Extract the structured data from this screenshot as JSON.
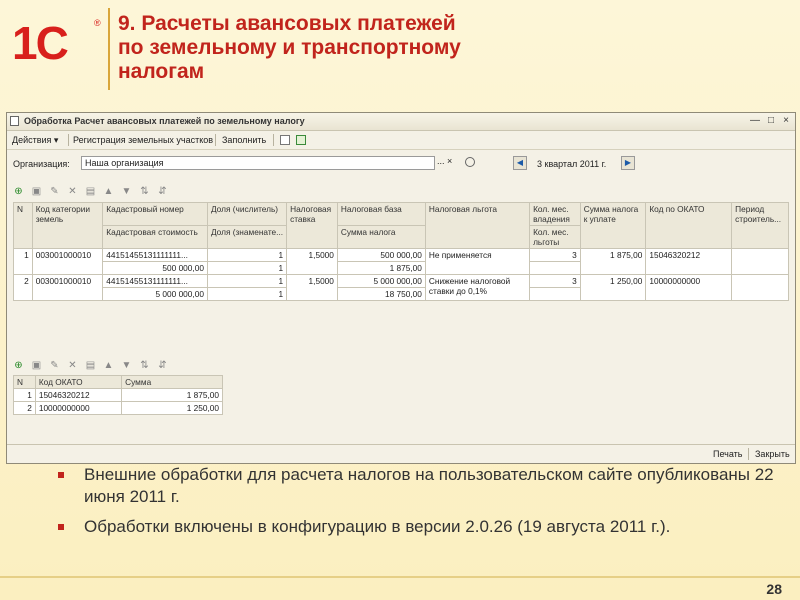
{
  "slide": {
    "title_lines": [
      "9. Расчеты авансовых платежей",
      "по земельному и транспортному",
      "налогам"
    ],
    "logo_text": "1С",
    "logo_reg": "®",
    "bullets": [
      "Внешние обработки для расчета налогов на пользовательском сайте опубликованы 22 июня 2011 г.",
      "Обработки включены в конфигурацию в версии 2.0.26 (19 августа 2011 г.)."
    ],
    "page_number": "28"
  },
  "window": {
    "title": "Обработка  Расчет авансовых платежей по земельному налогу",
    "controls": [
      "—",
      "□",
      "×"
    ],
    "commands": {
      "actions": "Действия ▾",
      "register": "Регистрация земельных участков",
      "fill": "Заполнить"
    },
    "org_label": "Организация:",
    "org_value": "Наша организация",
    "org_buttons": "...  ×",
    "period": "3 квартал 2011 г.",
    "main_table": {
      "headers_top": [
        "N",
        "Код категории земель",
        "Кадастровый номер",
        "Доля (числитель)",
        "Налоговая ставка",
        "Налоговая база",
        "Налоговая льгота",
        "Кол. мес. владения",
        "Сумма налога к уплате",
        "Код по ОКАТО",
        "Период строитель..."
      ],
      "headers_bottom": [
        "",
        "",
        "Кадастровая стоимость",
        "Доля (знаменате...",
        "",
        "Сумма налога",
        "",
        "Кол. мес. льготы",
        "",
        "",
        ""
      ],
      "rows": [
        {
          "n": "1",
          "category": "003001000010",
          "cadastral_number": "44151455131111111...",
          "share_num": "1",
          "rate": "1,5000",
          "base": "500 000,00",
          "benefit": "Не применяется",
          "months": "3",
          "tax_due": "1 875,00",
          "okato": "15046320212",
          "period": "",
          "cadastral_value": "500 000,00",
          "share_den": "1",
          "tax_amount": "1 875,00",
          "benefit2": "",
          "benefit_months": ""
        },
        {
          "n": "2",
          "category": "003001000010",
          "cadastral_number": "44151455131111111...",
          "share_num": "1",
          "rate": "1,5000",
          "base": "5 000 000,00",
          "benefit": "Снижение налоговой",
          "months": "3",
          "tax_due": "1 250,00",
          "okato": "10000000000",
          "period": "",
          "cadastral_value": "5 000 000,00",
          "share_den": "1",
          "tax_amount": "18 750,00",
          "benefit2": "ставки до 0,1%",
          "benefit_months": ""
        }
      ]
    },
    "okato_table": {
      "headers": [
        "N",
        "Код ОКАТО",
        "Сумма"
      ],
      "rows": [
        {
          "n": "1",
          "code": "15046320212",
          "sum": "1 875,00"
        },
        {
          "n": "2",
          "code": "10000000000",
          "sum": "1 250,00"
        }
      ]
    },
    "bottom_buttons": {
      "print": "Печать",
      "close": "Закрыть"
    }
  },
  "colors": {
    "brand_red": "#c1241c",
    "logo_red": "#d8201c",
    "accent_gold": "#d9a63a"
  }
}
